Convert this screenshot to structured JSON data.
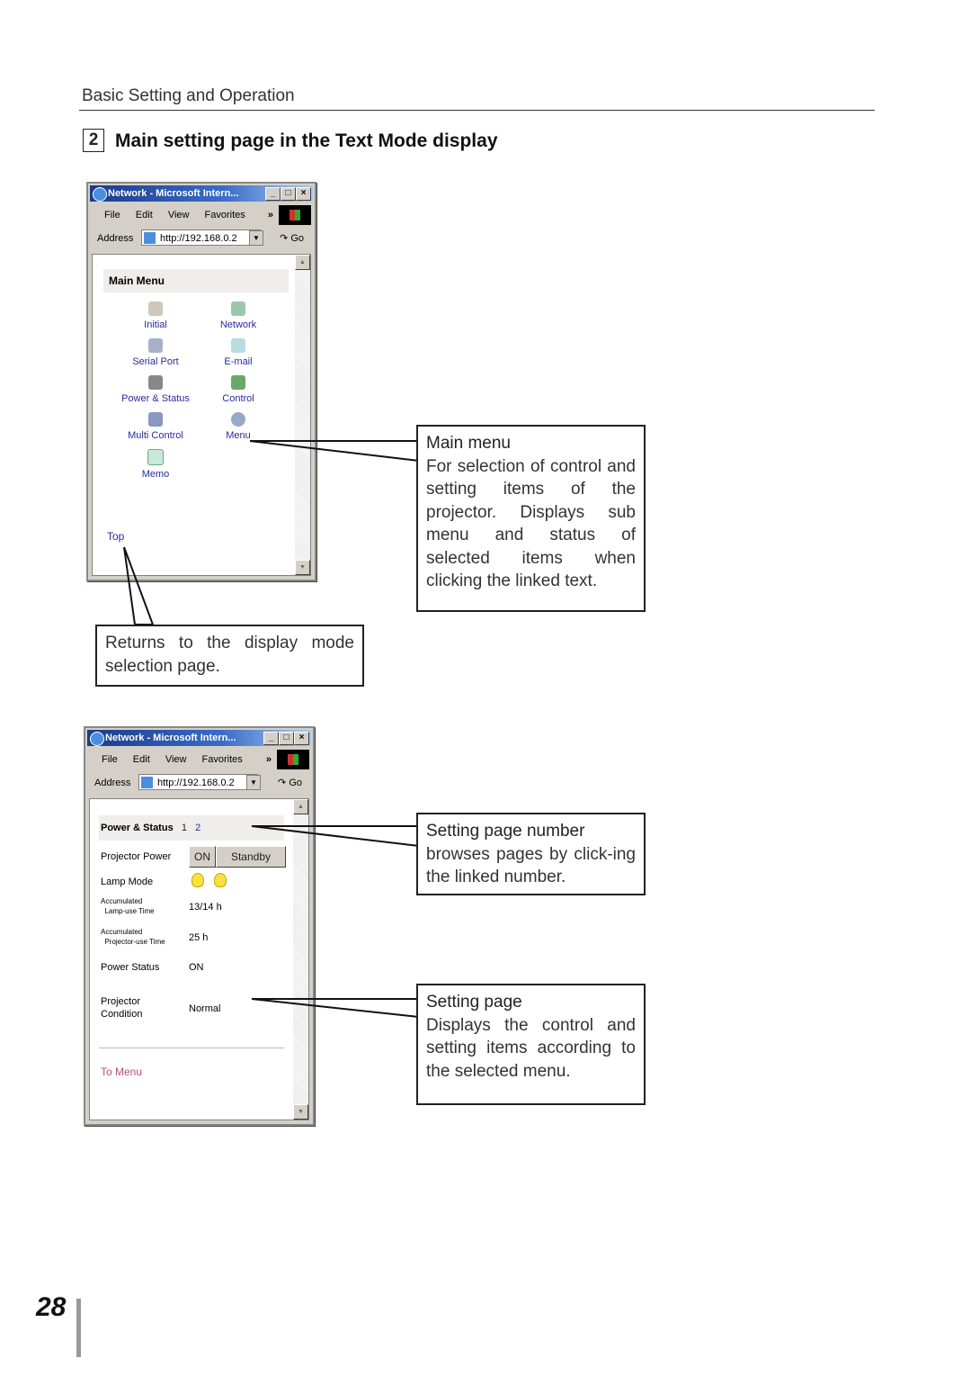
{
  "header": {
    "section_title": "Basic Setting and Operation"
  },
  "section": {
    "number": "2",
    "title": "Main setting page in the Text Mode display"
  },
  "browser": {
    "title": "Network - Microsoft Intern...",
    "menu": [
      "File",
      "Edit",
      "View",
      "Favorites"
    ],
    "chevron": "»",
    "address_label": "Address",
    "address_value": "http://192.168.0.2",
    "go_label": "Go",
    "minimize": "_",
    "maximize": "□",
    "close": "×"
  },
  "main_menu_page": {
    "heading": "Main Menu",
    "items": [
      {
        "label": "Initial",
        "icon": "lock-icon"
      },
      {
        "label": "Network",
        "icon": "network-icon"
      },
      {
        "label": "Serial Port",
        "icon": "serial-port-icon"
      },
      {
        "label": "E-mail",
        "icon": "email-icon"
      },
      {
        "label": "Power & Status",
        "icon": "projector-icon"
      },
      {
        "label": "Control",
        "icon": "control-icon"
      },
      {
        "label": "Multi Control",
        "icon": "multi-control-icon"
      },
      {
        "label": "Menu",
        "icon": "menu-icon"
      },
      {
        "label": "Memo",
        "icon": "memo-icon"
      }
    ],
    "top_link": "Top"
  },
  "power_status_page": {
    "heading": "Power & Status",
    "page_numbers": [
      "1",
      "2"
    ],
    "projector_power_label": "Projector Power",
    "on_button": "ON",
    "standby_button": "Standby",
    "lamp_mode_label": "Lamp Mode",
    "lamp_time_label_1": "Accumulated",
    "lamp_time_label_2": "Lamp-use Time",
    "lamp_time_value": "13/14 h",
    "projector_time_label_1": "Accumulated",
    "projector_time_label_2": "Projector-use Time",
    "projector_time_value": "25 h",
    "power_status_label": "Power Status",
    "power_status_value": "ON",
    "condition_label_1": "Projector",
    "condition_label_2": "Condition",
    "condition_value": "Normal",
    "to_menu_link": "To Menu"
  },
  "callouts": {
    "main_menu": {
      "title": "Main menu",
      "body": "For selection of  control and setting items of the projector. Displays sub menu and status of selected items when clicking the linked text."
    },
    "top": {
      "body": "Returns to the display mode selection page."
    },
    "page_number": {
      "title": "Setting page number",
      "body": "browses pages by click-ing the linked number."
    },
    "setting_page": {
      "title": "Setting page",
      "body": "Displays the control and setting items according to the selected menu."
    }
  },
  "page_number": "28"
}
